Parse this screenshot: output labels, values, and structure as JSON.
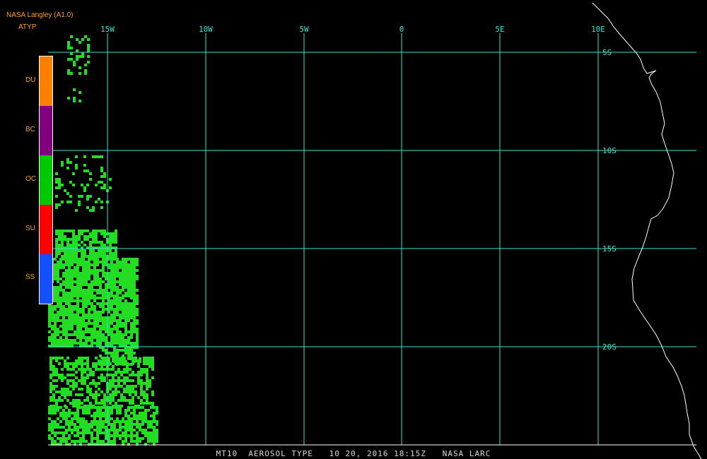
{
  "header": {
    "source": "NASA Langley (A1.0)",
    "product": "ATYP"
  },
  "legend": [
    {
      "code": "DU",
      "color": "#ff7f00"
    },
    {
      "code": "BC",
      "color": "#800080"
    },
    {
      "code": "OC",
      "color": "#00c800"
    },
    {
      "code": "SU",
      "color": "#ff0000"
    },
    {
      "code": "SS",
      "color": "#1450ff"
    }
  ],
  "map": {
    "grid_color": "#40e0d0",
    "coast_color": "#ffffff",
    "aerosol_color": "#22dd22",
    "lon_labels": [
      "15W",
      "10W",
      "5W",
      "0",
      "5E",
      "10E"
    ],
    "lat_labels": [
      "5S",
      "10S",
      "15S",
      "20S"
    ]
  },
  "footer": "MT10  AEROSOL TYPE   10 20, 2016 18:15Z   NASA LARC"
}
